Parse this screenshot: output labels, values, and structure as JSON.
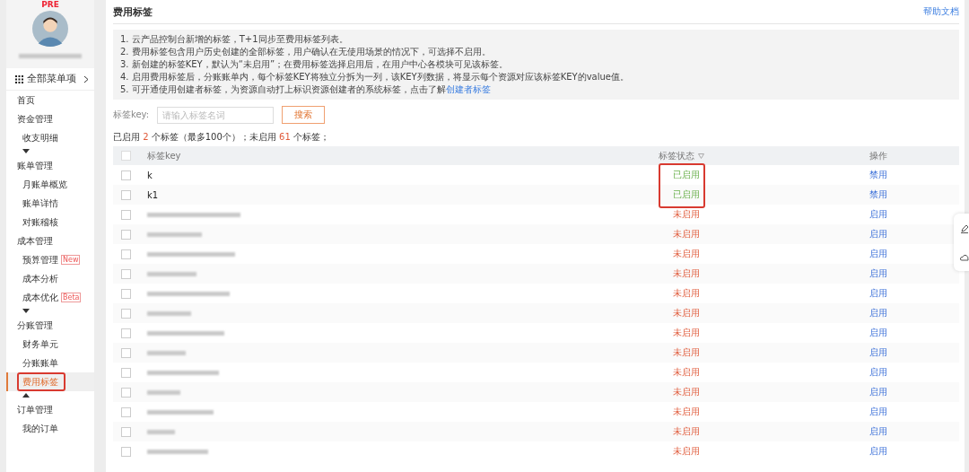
{
  "sidebar": {
    "badge": "PRE",
    "menu_all": {
      "label": "全部菜单项"
    },
    "items": [
      {
        "label": "首页"
      },
      {
        "label": "资金管理",
        "children": [
          {
            "label": "收支明细",
            "selected": false
          }
        ],
        "toggle": {
          "expanded": false
        }
      },
      {
        "label": "账单管理",
        "children": [
          {
            "label": "月账单概览",
            "selected": false
          },
          {
            "label": "账单详情",
            "selected": false
          },
          {
            "label": "对账稽核",
            "selected": false
          }
        ]
      },
      {
        "label": "成本管理",
        "children": [
          {
            "label": "预算管理",
            "selected": false,
            "tag": "New"
          },
          {
            "label": "成本分析",
            "selected": false
          },
          {
            "label": "成本优化",
            "selected": false,
            "tag": "Beta"
          }
        ],
        "toggle": {
          "expanded": false
        }
      },
      {
        "label": "分账管理",
        "children": [
          {
            "label": "财务单元",
            "selected": false
          },
          {
            "label": "分账账单",
            "selected": false
          },
          {
            "label": "费用标签",
            "selected": true,
            "annotated": true
          }
        ],
        "toggle": {
          "expanded": true
        }
      },
      {
        "label": "订单管理",
        "children": [
          {
            "label": "我的订单",
            "selected": false
          }
        ]
      }
    ]
  },
  "header": {
    "title": "费用标签",
    "help_link": "帮助文档"
  },
  "notes": [
    {
      "text": "1. 云产品控制台新增的标签，T+1同步至费用标签列表。"
    },
    {
      "text": "2. 费用标签包含用户历史创建的全部标签，用户确认在无使用场景的情况下，可选择不启用。"
    },
    {
      "text": "3. 新创建的标签KEY，默认为“未启用”；在费用标签选择启用后，在用户中心各模块可见该标签。"
    },
    {
      "text": "4. 启用费用标签后，分账账单内，每个标签KEY将独立分拆为一列，该KEY列数据，将显示每个资源对应该标签KEY的value值。"
    },
    {
      "text": "5. 可开通使用创建者标签，为资源自动打上标识资源创建者的系统标签，点击了解",
      "link": "创建者标签"
    }
  ],
  "search": {
    "label": "标签key:",
    "placeholder": "请输入标签名词",
    "button": "搜索"
  },
  "summary": [
    {
      "text": "已启用 ",
      "highlight": false
    },
    {
      "text": "2",
      "highlight": true
    },
    {
      "text": " 个标签（最多100个）；未启用 ",
      "highlight": false
    },
    {
      "text": "61",
      "highlight": true
    },
    {
      "text": " 个标签；",
      "highlight": false
    }
  ],
  "table": {
    "select_all_checked": false,
    "columns": [
      "标签key",
      "标签状态",
      "操作"
    ],
    "rows": [
      {
        "key": "k",
        "status": "已启用",
        "enabled": true,
        "action": "禁用",
        "checked": false,
        "annotated": true
      },
      {
        "key": "k1",
        "status": "已启用",
        "enabled": true,
        "action": "禁用",
        "checked": false,
        "annotated": true
      },
      {
        "redacted": true,
        "status": "未启用",
        "enabled": false,
        "action": "启用",
        "checked": false
      },
      {
        "redacted": true,
        "status": "未启用",
        "enabled": false,
        "action": "启用",
        "checked": false
      },
      {
        "redacted": true,
        "status": "未启用",
        "enabled": false,
        "action": "启用",
        "checked": false
      },
      {
        "redacted": true,
        "status": "未启用",
        "enabled": false,
        "action": "启用",
        "checked": false
      },
      {
        "redacted": true,
        "status": "未启用",
        "enabled": false,
        "action": "启用",
        "checked": false
      },
      {
        "redacted": true,
        "status": "未启用",
        "enabled": false,
        "action": "启用",
        "checked": false
      },
      {
        "redacted": true,
        "status": "未启用",
        "enabled": false,
        "action": "启用",
        "checked": false
      },
      {
        "redacted": true,
        "status": "未启用",
        "enabled": false,
        "action": "启用",
        "checked": false
      },
      {
        "redacted": true,
        "status": "未启用",
        "enabled": false,
        "action": "启用",
        "checked": false
      },
      {
        "redacted": true,
        "status": "未启用",
        "enabled": false,
        "action": "启用",
        "checked": false
      },
      {
        "redacted": true,
        "status": "未启用",
        "enabled": false,
        "action": "启用",
        "checked": false
      },
      {
        "redacted": true,
        "status": "未启用",
        "enabled": false,
        "action": "启用",
        "checked": false
      },
      {
        "redacted": true,
        "status": "未启用",
        "enabled": false,
        "action": "启用",
        "checked": false
      }
    ]
  }
}
